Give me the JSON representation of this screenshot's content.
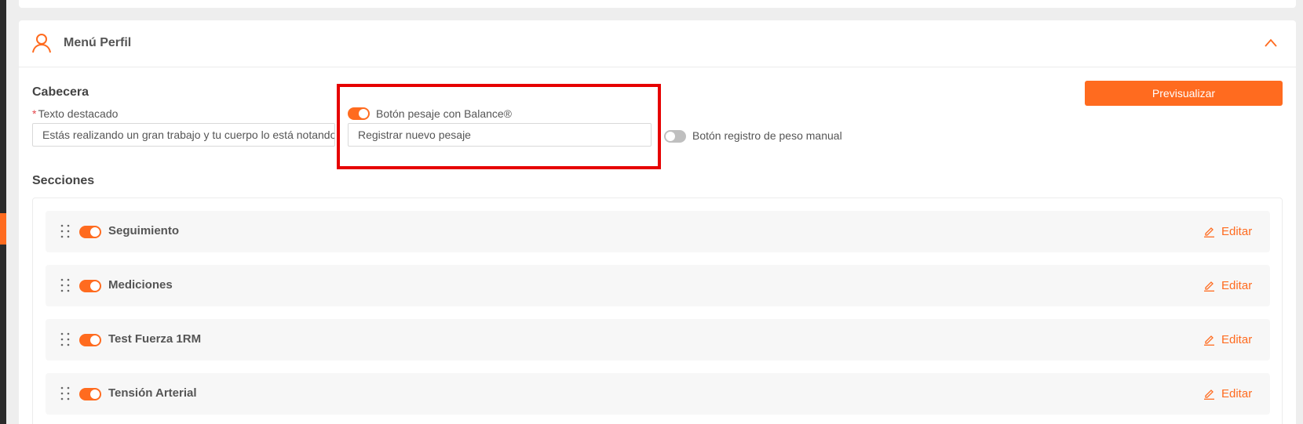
{
  "colors": {
    "accent": "#ff6b1f",
    "highlight": "#e60000",
    "toggle_off": "#bfbfbf",
    "required": "#e5484d"
  },
  "panel": {
    "title": "Menú Perfil",
    "icon": "user-icon",
    "collapse_icon": "chevron-up-icon"
  },
  "header_section": {
    "title": "Cabecera",
    "featured_text": {
      "required_mark": "*",
      "label": "Texto destacado",
      "value": "Estás realizando un gran trabajo y tu cuerpo lo está notando"
    },
    "balance_button": {
      "label": "Botón pesaje con Balance®",
      "enabled": true,
      "value": "Registrar nuevo pesaje"
    },
    "manual_weight_button": {
      "label": "Botón registro de peso manual",
      "enabled": false
    },
    "preview_button": "Previsualizar"
  },
  "sections": {
    "title": "Secciones",
    "edit_label": "Editar",
    "items": [
      {
        "label": "Seguimiento",
        "enabled": true
      },
      {
        "label": "Mediciones",
        "enabled": true
      },
      {
        "label": "Test Fuerza 1RM",
        "enabled": true
      },
      {
        "label": "Tensión Arterial",
        "enabled": true
      }
    ]
  }
}
